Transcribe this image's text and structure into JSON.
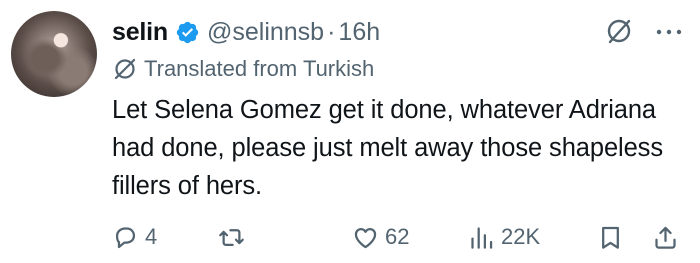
{
  "author": {
    "name": "selin",
    "handle": "@selinnsb",
    "separator": "·",
    "time": "16h",
    "avatar_icon": "profile-photo"
  },
  "translation": {
    "label": "Translated from Turkish",
    "icon": "translate-icon"
  },
  "tweet": {
    "text": "Let Selena Gomez get it done, whatever Adriana had done, please just melt away those shapeless fillers of hers."
  },
  "stats": {
    "replies": "4",
    "reposts": "",
    "likes": "62",
    "views": "22K"
  },
  "colors": {
    "text": "#0f1419",
    "muted": "#536471",
    "verified": "#1d9bf0"
  }
}
